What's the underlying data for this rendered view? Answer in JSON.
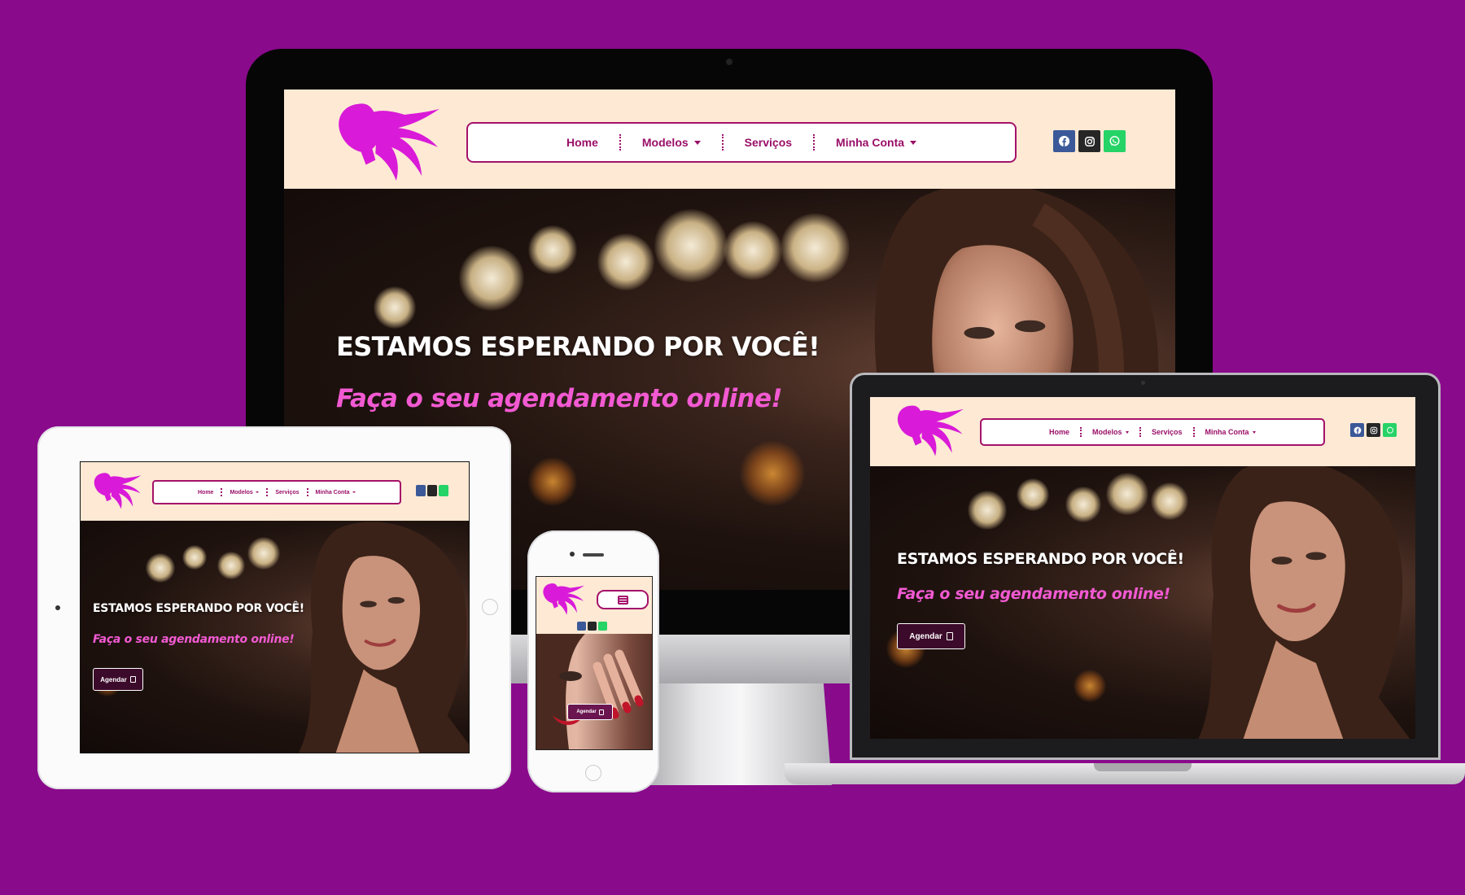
{
  "colors": {
    "background": "#8a0a8c",
    "header_bg": "#fde9d4",
    "nav_text": "#9a0f68",
    "nav_border": "#a4126a",
    "logo": "#d91ad8",
    "subtitle": "#f25ad2",
    "button_bg": "#3c0a2a",
    "facebook": "#3b5998",
    "instagram": "#262626",
    "whatsapp": "#25d366"
  },
  "nav": {
    "home": "Home",
    "modelos": "Modelos",
    "servicos": "Serviços",
    "minha_conta": "Minha Conta"
  },
  "social_icons": [
    "facebook-icon",
    "instagram-icon",
    "whatsapp-icon"
  ],
  "hero": {
    "title": "ESTAMOS ESPERANDO POR VOCÊ!",
    "subtitle": "Faça o seu agendamento online!",
    "button": "Agendar"
  },
  "mobile": {
    "menu_icon": "hamburger-icon",
    "button": "Agendar"
  }
}
